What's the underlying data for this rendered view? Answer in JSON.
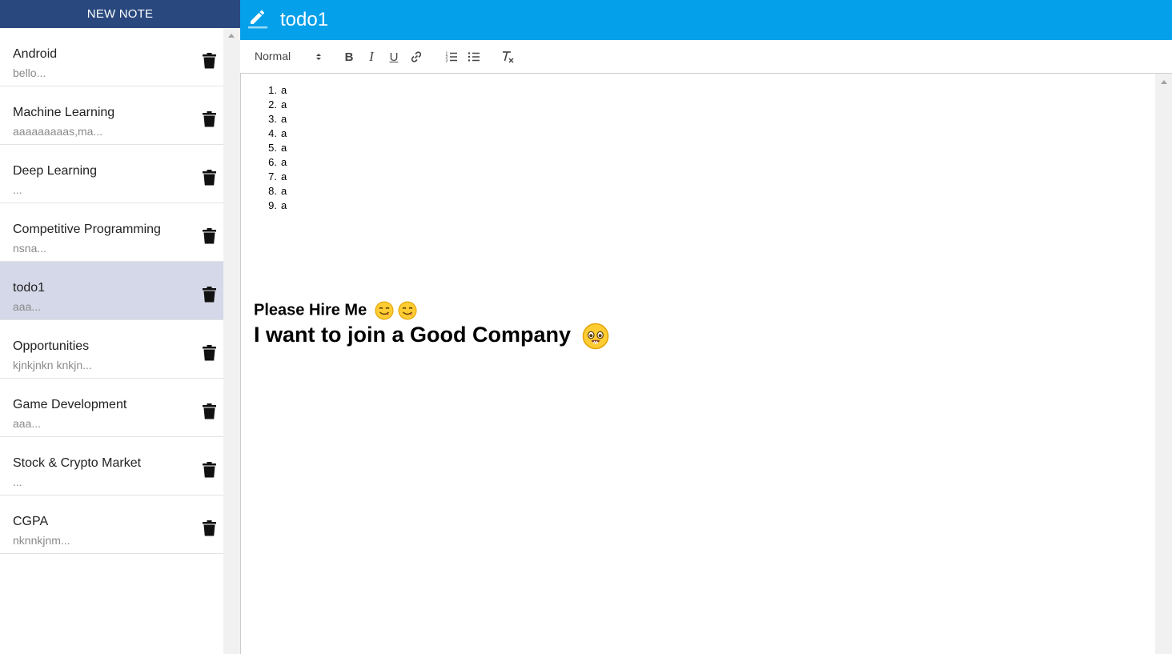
{
  "sidebar": {
    "new_note_label": "NEW NOTE",
    "notes": [
      {
        "title": "Android",
        "preview": "bello..."
      },
      {
        "title": "Machine Learning",
        "preview": "aaaaaaaaas,ma..."
      },
      {
        "title": "Deep Learning",
        "preview": "..."
      },
      {
        "title": "Competitive Programming",
        "preview": "nsna..."
      },
      {
        "title": "todo1",
        "preview": "aaa...",
        "selected": true
      },
      {
        "title": "Opportunities",
        "preview": "kjnkjnkn knkjn..."
      },
      {
        "title": "Game Development",
        "preview": "aaa..."
      },
      {
        "title": "Stock & Crypto Market",
        "preview": "..."
      },
      {
        "title": "CGPA",
        "preview": "nknnkjnm..."
      }
    ]
  },
  "header": {
    "title": "todo1",
    "icon": "pencil-icon"
  },
  "toolbar": {
    "format_value": "Normal",
    "buttons": [
      "bold",
      "italic",
      "underline",
      "link",
      "ordered-list",
      "bullet-list",
      "clean-format"
    ],
    "bold_label": "B",
    "italic_label": "I",
    "underline_label": "U"
  },
  "editor": {
    "list_items": [
      "a",
      "a",
      "a",
      "a",
      "a",
      "a",
      "a",
      "a",
      "a"
    ],
    "line1": "Please Hire Me",
    "line2": "I want to join a Good Company"
  },
  "colors": {
    "new_note_bg": "#29487d",
    "header_bg": "#05a0ea",
    "selected_item_bg": "#d5d8e8"
  }
}
